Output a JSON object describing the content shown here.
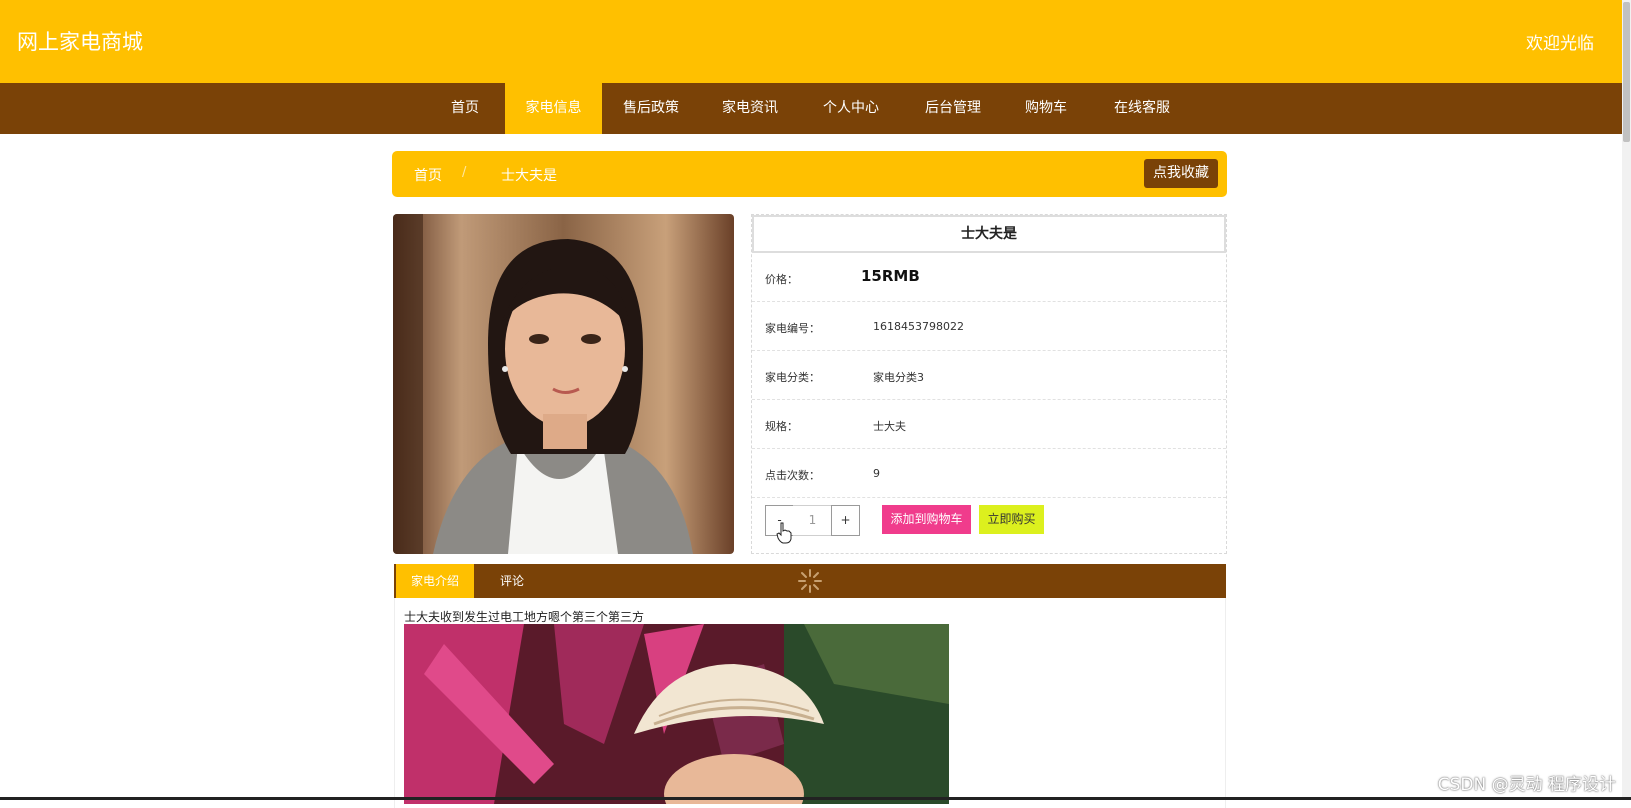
{
  "header": {
    "site_title": "网上家电商城",
    "welcome": "欢迎光临",
    "brand_color": "#ffc000",
    "nav_color": "#7a4207"
  },
  "nav": {
    "items": [
      {
        "label": "首页"
      },
      {
        "label": "家电信息",
        "active": true
      },
      {
        "label": "售后政策"
      },
      {
        "label": "家电资讯"
      },
      {
        "label": "个人中心"
      },
      {
        "label": "后台管理"
      },
      {
        "label": "购物车"
      },
      {
        "label": "在线客服"
      }
    ]
  },
  "breadcrumb": {
    "home": "首页",
    "separator": "/",
    "current": "士大夫是",
    "favorite_button": "点我收藏"
  },
  "product": {
    "name": "士大夫是",
    "price_label": "价格：",
    "price": "15RMB",
    "code_label": "家电编号：",
    "code": "1618453798022",
    "category_label": "家电分类：",
    "category": "家电分类3",
    "spec_label": "规格：",
    "spec": "士大夫",
    "clicks_label": "点击次数：",
    "clicks": "9",
    "quantity": {
      "minus": "-",
      "value": "1",
      "plus": "+"
    },
    "add_to_cart": "添加到购物车",
    "buy_now": "立即购买",
    "add_color": "#f03c8c",
    "buy_color": "#dcf01e"
  },
  "tabs": {
    "items": [
      {
        "label": "家电介绍",
        "active": true
      },
      {
        "label": "评论"
      }
    ]
  },
  "description": {
    "text": "士大夫收到发生过电工地方嗯个第三个第三方"
  },
  "watermark": "CSDN @灵动 程序设计"
}
